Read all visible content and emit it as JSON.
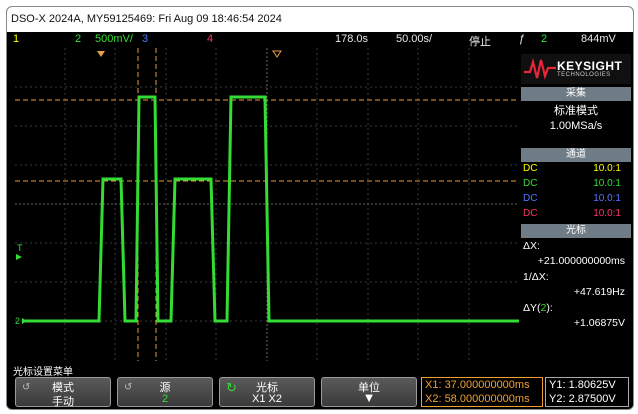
{
  "window": {
    "title": "DSO-X 2024A, MY59125469: Fri Aug 09 18:46:54 2024"
  },
  "status": {
    "ch1": "1",
    "ch2": "2",
    "ch2_scale": "500&#x2032;/",
    "ch2_scale_text": "500mV/",
    "ch3": "3",
    "ch4": "4",
    "time_pos": "178.0&#x2032;",
    "time_pos_text": "178.0s",
    "time_scale": "50.00s/",
    "run_state": "停止",
    "trigger_icon": "trigger-edge-icon",
    "trigger_ch": "2",
    "trigger_level": "844mV",
    "colors": {
      "ch1": "#ffff00",
      "ch2": "#33dd33",
      "ch3": "#5577ff",
      "ch4": "#ff3366"
    }
  },
  "scope": {
    "grid_color": "#3a3a3a"
  },
  "panel": {
    "logo": {
      "word": "KEYSIGHT",
      "sub": "TECHNOLOGIES"
    },
    "acq": {
      "header": "采集",
      "mode": "标准模式",
      "rate": "1.00MSa/s"
    },
    "channels": {
      "header": "通道",
      "rows": [
        {
          "coupling": "DC",
          "probe": "10.0:1",
          "color": "#ffff00"
        },
        {
          "coupling": "DC",
          "probe": "10.0:1",
          "color": "#33dd33"
        },
        {
          "coupling": "DC",
          "probe": "10.0:1",
          "color": "#5577ff"
        },
        {
          "coupling": "DC",
          "probe": "10.0:1",
          "color": "#ff3366"
        }
      ]
    },
    "cursor": {
      "header": "光标",
      "dx_label": "ΔX:",
      "dx_value": "+21.000000000ms",
      "inv_label": "1/ΔX:",
      "inv_value": "+47.619Hz",
      "dy_label": "ΔY(",
      "dy_ch": "2",
      "dy_label_end": "):",
      "dy_value": "+1.06875V"
    }
  },
  "softkeys": {
    "menu_title": "光标设置菜单",
    "mode": {
      "label": "模式",
      "value": "手动"
    },
    "source": {
      "label": "源",
      "value": "2"
    },
    "cursors": {
      "label": "光标",
      "value": "X1 X2"
    },
    "units": {
      "label": "单位"
    },
    "x1": "X1: 37.000000000ms",
    "x2": "X2: 58.000000000ms",
    "y1": "Y1: 1.80625V",
    "y2": "Y2: 2.87500V"
  }
}
